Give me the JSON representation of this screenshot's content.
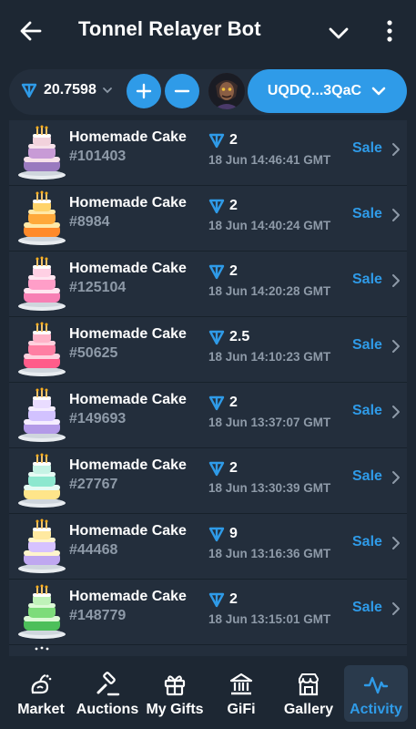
{
  "header": {
    "title": "Tonnel Relayer Bot",
    "back_icon": "arrow-left-icon",
    "dropdown_icon": "chevron-down-icon",
    "menu_icon": "more-vertical-icon"
  },
  "toolbar": {
    "balance": "20.7598",
    "plus_icon": "plus-icon",
    "minus_icon": "minus-icon",
    "wallet_label": "UQDQ...3QaC"
  },
  "colors": {
    "accent": "#2f9be8",
    "background": "#1d2733",
    "row_background": "#232e3c",
    "muted_text": "#8e9aa8"
  },
  "activity": [
    {
      "name": "Homemade Cake",
      "id": "#101403",
      "price": "2",
      "time": "18 Jun 14:46:41 GMT",
      "action": "Sale"
    },
    {
      "name": "Homemade Cake",
      "id": "#8984",
      "price": "2",
      "time": "18 Jun 14:40:24 GMT",
      "action": "Sale"
    },
    {
      "name": "Homemade Cake",
      "id": "#125104",
      "price": "2",
      "time": "18 Jun 14:20:28 GMT",
      "action": "Sale"
    },
    {
      "name": "Homemade Cake",
      "id": "#50625",
      "price": "2.5",
      "time": "18 Jun 14:10:23 GMT",
      "action": "Sale"
    },
    {
      "name": "Homemade Cake",
      "id": "#149693",
      "price": "2",
      "time": "18 Jun 13:37:07 GMT",
      "action": "Sale"
    },
    {
      "name": "Homemade Cake",
      "id": "#27767",
      "price": "2",
      "time": "18 Jun 13:30:39 GMT",
      "action": "Sale"
    },
    {
      "name": "Homemade Cake",
      "id": "#44468",
      "price": "9",
      "time": "18 Jun 13:16:36 GMT",
      "action": "Sale"
    },
    {
      "name": "Homemade Cake",
      "id": "#148779",
      "price": "2",
      "time": "18 Jun 13:15:01 GMT",
      "action": "Sale"
    }
  ],
  "nav": {
    "market": "Market",
    "auctions": "Auctions",
    "my_gifts": "My Gifts",
    "gifi": "GiFi",
    "gallery": "Gallery",
    "activity": "Activity"
  }
}
